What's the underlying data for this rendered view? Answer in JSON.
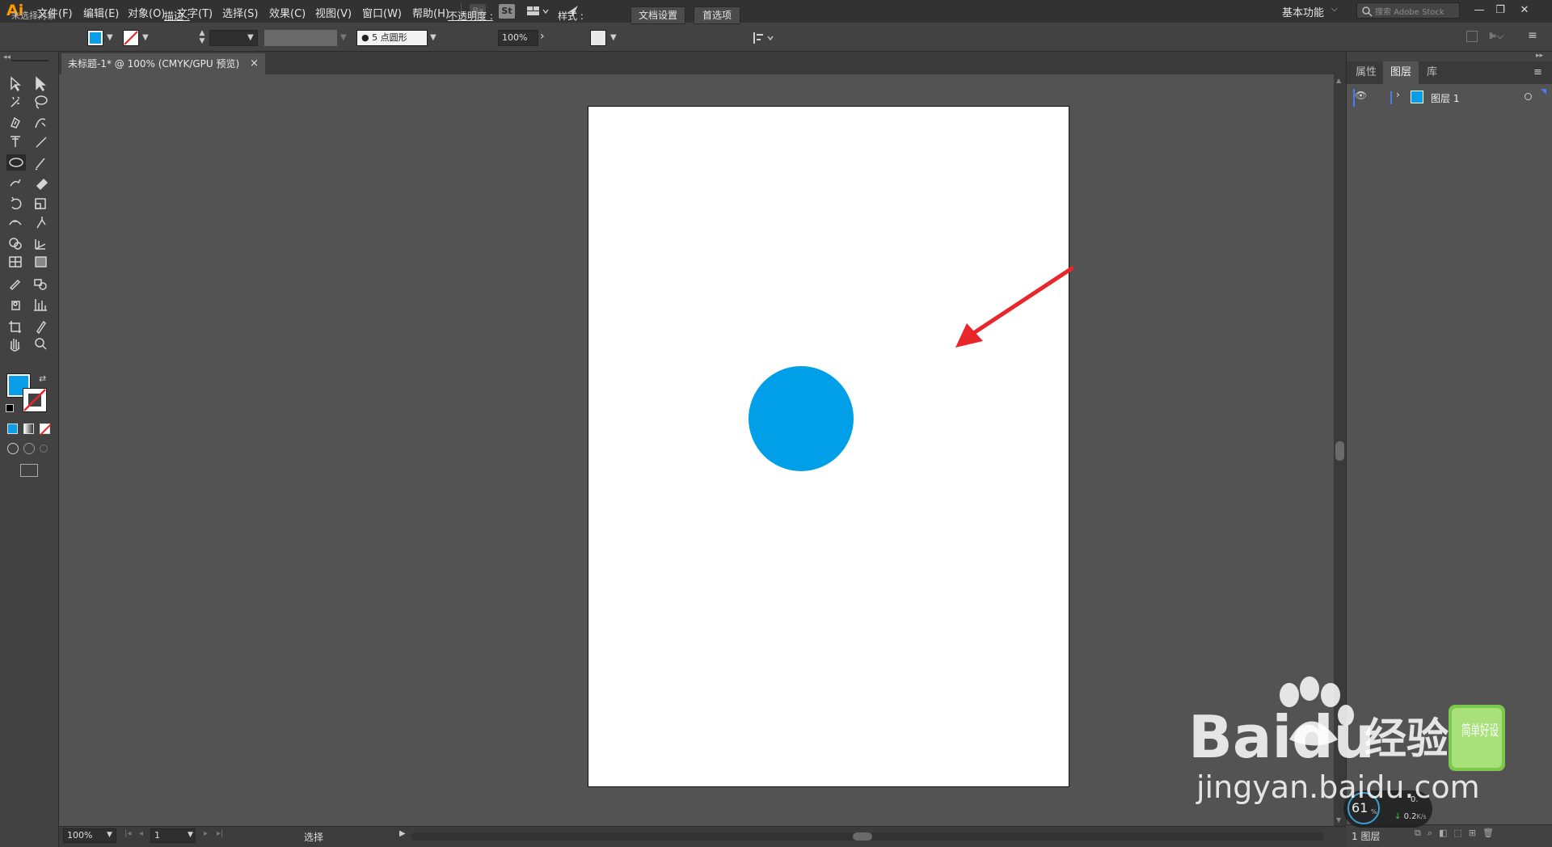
{
  "menu": {
    "app_logo": "Ai",
    "items": [
      "文件(F)",
      "编辑(E)",
      "对象(O)",
      "文字(T)",
      "选择(S)",
      "效果(C)",
      "视图(V)",
      "窗口(W)",
      "帮助(H)"
    ],
    "bridge": "Br",
    "stock": "St",
    "workspace": "基本功能",
    "search_placeholder": "搜索 Adobe Stock"
  },
  "control": {
    "selection_status": "未选择对象",
    "stroke_label": "描边 :",
    "brush_size": "5",
    "brush_name": "点圆形",
    "opacity_label": "不透明度 :",
    "opacity_value": "100%",
    "style_label": "样式 :",
    "doc_setup": "文档设置",
    "preferences": "首选项"
  },
  "document": {
    "tab_title": "未标题-1* @ 100% (CMYK/GPU 预览)",
    "close": "×"
  },
  "colors": {
    "fill": "#0a9ee8",
    "circle": "#009fe8",
    "annotation_arrow": "#e8262b",
    "layer_accent": "#4b7cf0"
  },
  "status": {
    "zoom": "100%",
    "artboard": "1",
    "tool": "选择"
  },
  "panel": {
    "tabs": [
      "属性",
      "图层",
      "库"
    ],
    "active_tab": "图层",
    "layer_name": "图层 1",
    "footer_label": "1 图层"
  },
  "overlay": {
    "cpu_percent": "61",
    "net_up": "0.",
    "net_down": "0.2",
    "net_unit": "K/s"
  },
  "watermark": {
    "brand": "Baidu",
    "brand_cn": "经验",
    "url": "jingyan.baidu.com",
    "badge": "简单好设"
  }
}
